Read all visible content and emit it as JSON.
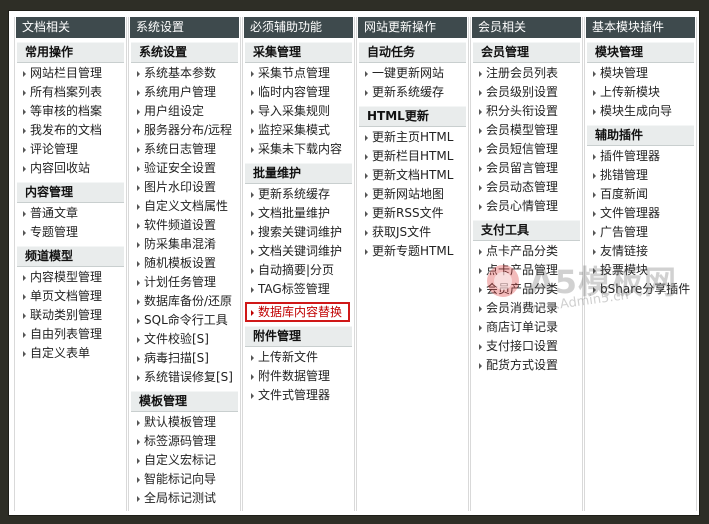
{
  "columns": [
    {
      "title": "文档相关",
      "sections": [
        {
          "name": "常用操作",
          "items": [
            "网站栏目管理",
            "所有档案列表",
            "等审核的档案",
            "我发布的文档",
            "评论管理",
            "内容回收站"
          ]
        },
        {
          "name": "内容管理",
          "items": [
            "普通文章",
            "专题管理"
          ]
        },
        {
          "name": "频道模型",
          "items": [
            "内容模型管理",
            "单页文档管理",
            "联动类别管理",
            "自由列表管理",
            "自定义表单"
          ]
        }
      ]
    },
    {
      "title": "系统设置",
      "sections": [
        {
          "name": "系统设置",
          "items": [
            "系统基本参数",
            "系统用户管理",
            "用户组设定",
            "服务器分布/远程",
            "系统日志管理",
            "验证安全设置",
            "图片水印设置",
            "自定义文档属性",
            "软件频道设置",
            "防采集串混淆",
            "随机模板设置",
            "计划任务管理",
            "数据库备份/还原",
            "SQL命令行工具",
            "文件校验[S]",
            "病毒扫描[S]",
            "系统错误修复[S]"
          ]
        },
        {
          "name": "模板管理",
          "items": [
            "默认模板管理",
            "标签源码管理",
            "自定义宏标记",
            "智能标记向导",
            "全局标记测试"
          ]
        }
      ]
    },
    {
      "title": "必须辅助功能",
      "sections": [
        {
          "name": "采集管理",
          "items": [
            "采集节点管理",
            "临时内容管理",
            "导入采集规则",
            "监控采集模式",
            "采集未下载内容"
          ]
        },
        {
          "name": "批量维护",
          "items": [
            "更新系统缓存",
            "文档批量维护",
            "搜索关键词维护",
            "文档关键词维护",
            "自动摘要|分页",
            "TAG标签管理",
            "数据库内容替换"
          ]
        },
        {
          "name": "附件管理",
          "items": [
            "上传新文件",
            "附件数据管理",
            "文件式管理器"
          ]
        }
      ]
    },
    {
      "title": "网站更新操作",
      "sections": [
        {
          "name": "自动任务",
          "items": [
            "一键更新网站",
            "更新系统缓存"
          ]
        },
        {
          "name": "HTML更新",
          "items": [
            "更新主页HTML",
            "更新栏目HTML",
            "更新文档HTML",
            "更新网站地图",
            "更新RSS文件",
            "获取JS文件",
            "更新专题HTML"
          ]
        }
      ]
    },
    {
      "title": "会员相关",
      "sections": [
        {
          "name": "会员管理",
          "items": [
            "注册会员列表",
            "会员级别设置",
            "积分头衔设置",
            "会员模型管理",
            "会员短信管理",
            "会员留言管理",
            "会员动态管理",
            "会员心情管理"
          ]
        },
        {
          "name": "支付工具",
          "items": [
            "点卡产品分类",
            "点卡产品管理",
            "会员产品分类",
            "会员消费记录",
            "商店订单记录",
            "支付接口设置",
            "配货方式设置"
          ]
        }
      ]
    },
    {
      "title": "基本模块插件",
      "sections": [
        {
          "name": "模块管理",
          "items": [
            "模块管理",
            "上传新模块",
            "模块生成向导"
          ]
        },
        {
          "name": "辅助插件",
          "items": [
            "插件管理器",
            "挑错管理",
            "百度新闻",
            "文件管理器",
            "广告管理",
            "友情链接",
            "投票模块",
            "bShare分享插件"
          ]
        }
      ]
    }
  ],
  "highlighted_item": "数据库内容替换",
  "watermark": {
    "text": "A5模板网",
    "url": "www.Admin5.cn"
  }
}
